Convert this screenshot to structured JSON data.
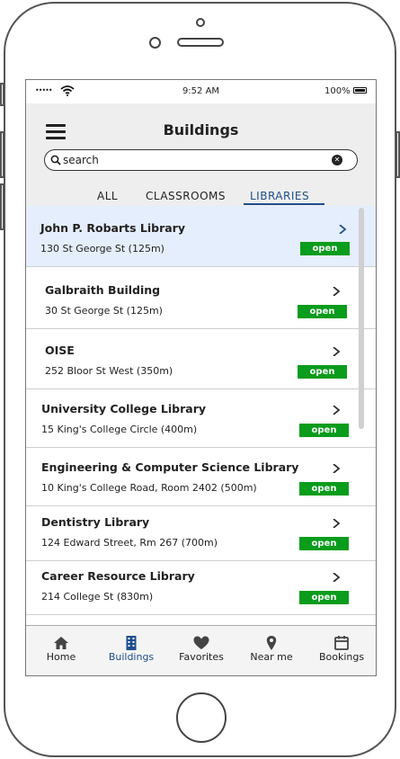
{
  "status_bar": {
    "signal": "•••••",
    "time": "9:52 AM",
    "battery": "100%"
  },
  "header": {
    "title": "Buildings"
  },
  "search": {
    "placeholder": "search"
  },
  "tabs": [
    {
      "label": "ALL",
      "active": false
    },
    {
      "label": "CLASSROOMS",
      "active": false
    },
    {
      "label": "LIBRARIES",
      "active": true
    }
  ],
  "buildings": [
    {
      "name": "John P. Robarts Library",
      "address": "130 St George St (125m)",
      "status": "open",
      "selected": true
    },
    {
      "name": "Galbraith Building",
      "address": "30 St George St (125m)",
      "status": "open",
      "selected": false
    },
    {
      "name": "OISE",
      "address": "252 Bloor St West (350m)",
      "status": "open",
      "selected": false
    },
    {
      "name": "University College Library",
      "address": "15 King's College Circle (400m)",
      "status": "open",
      "selected": false
    },
    {
      "name": "Engineering & Computer Science Library",
      "address": "10 King's College Road, Room 2402 (500m)",
      "status": "open",
      "selected": false
    },
    {
      "name": "Dentistry Library",
      "address": "124 Edward Street, Rm 267 (700m)",
      "status": "open",
      "selected": false
    },
    {
      "name": "Career Resource Library",
      "address": "214 College St (830m)",
      "status": "open",
      "selected": false
    }
  ],
  "tabbar": [
    {
      "label": "Home",
      "icon": "home-icon",
      "active": false
    },
    {
      "label": "Buildings",
      "icon": "building-icon",
      "active": true
    },
    {
      "label": "Favorites",
      "icon": "heart-icon",
      "active": false
    },
    {
      "label": "Near me",
      "icon": "location-pin-icon",
      "active": false
    },
    {
      "label": "Bookings",
      "icon": "calendar-icon",
      "active": false
    }
  ],
  "colors": {
    "accent": "#1f4e8c",
    "open_badge": "#0a9c1c",
    "selected_row": "#e5eefc",
    "header_bg": "#eeeeee"
  }
}
